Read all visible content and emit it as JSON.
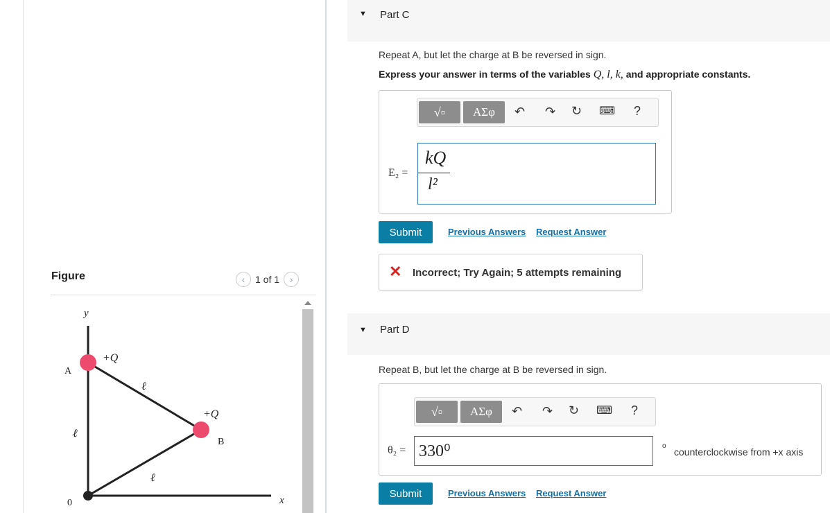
{
  "figure": {
    "title": "Figure",
    "pager_text": "1 of 1",
    "labels": {
      "y": "y",
      "A": "A",
      "B": "B",
      "origin": "0",
      "x": "x",
      "charge_A": "+Q",
      "charge_B": "+Q",
      "side_AB": "ℓ",
      "side_OA": "ℓ",
      "side_OB": "ℓ"
    },
    "colors": {
      "charge": "#ec4b6e",
      "origin_dot": "#222222"
    }
  },
  "partC": {
    "header": "Part C",
    "prompt": "Repeat A, but let the charge at B be reversed in sign.",
    "instruction_prefix": "Express your answer in terms of the variables",
    "instruction_vars": "Q, l, k,",
    "instruction_suffix": "and appropriate constants.",
    "toolbar": {
      "templates": "√▫",
      "greek": "ΑΣφ",
      "help": "?"
    },
    "lhs": "E₂ =",
    "answer_numerator": "kQ",
    "answer_denominator": "l²",
    "submit": "Submit",
    "previous_answers": "Previous Answers",
    "request_answer": "Request Answer",
    "feedback": "Incorrect; Try Again; 5 attempts remaining"
  },
  "partD": {
    "header": "Part D",
    "prompt": "Repeat B, but let the charge at B be reversed in sign.",
    "toolbar": {
      "templates": "√▫",
      "greek": "ΑΣφ",
      "help": "?"
    },
    "lhs": "θ₂ =",
    "answer_value": "330⁰",
    "unit_symbol": "o",
    "unit_text": "counterclockwise from +x axis",
    "submit": "Submit",
    "previous_answers": "Previous Answers",
    "request_answer": "Request Answer"
  }
}
